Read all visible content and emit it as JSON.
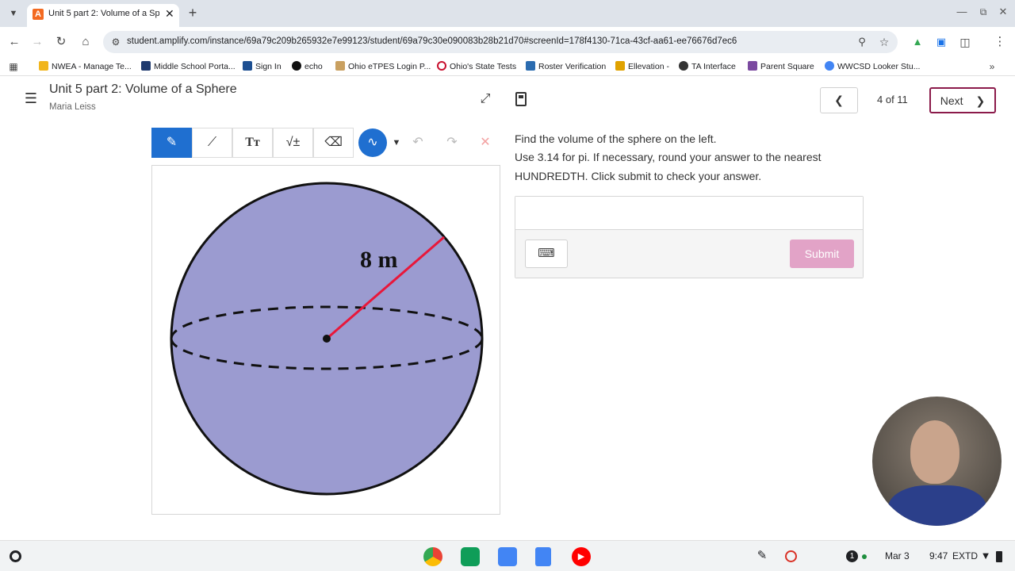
{
  "browser": {
    "tab_title": "Unit 5 part 2: Volume of a Sphe",
    "tab_favicon_letter": "A",
    "url": "student.amplify.com/instance/69a79c209b265932e7e99123/student/69a79c30e090083b28b21d70#screenId=178f4130-71ca-43cf-aa61-ee76676d7ec6",
    "bookmarks": [
      {
        "label": "NWEA - Manage Te...",
        "color": "#f1b51c"
      },
      {
        "label": "Middle School Porta...",
        "color": "#1f3a6e"
      },
      {
        "label": "Sign In",
        "color": "#1d4f91"
      },
      {
        "label": "echo",
        "color": "#111111"
      },
      {
        "label": "Ohio eTPES Login P...",
        "color": "#c9a060"
      },
      {
        "label": "Ohio's State Tests",
        "color": "#c8102e"
      },
      {
        "label": "Roster Verification",
        "color": "#2b6cb0"
      },
      {
        "label": "Ellevation -",
        "color": "#e0a200"
      },
      {
        "label": "TA Interface",
        "color": "#333333"
      },
      {
        "label": "Parent Square",
        "color": "#7b4aa0"
      },
      {
        "label": "WWCSD Looker Stu...",
        "color": "#4285f4"
      }
    ]
  },
  "header": {
    "title": "Unit 5 part 2: Volume of a Sphere",
    "student": "Maria Leiss",
    "page_count": "4 of 11",
    "next_label": "Next"
  },
  "figure": {
    "radius_label": "8 m",
    "fill_color": "#9b9bd0",
    "radius_color": "#e8173a"
  },
  "question": {
    "line1": "Find the volume of the sphere on the left.",
    "line2": "Use 3.14 for pi. If necessary, round your answer to the nearest",
    "line3": "HUNDREDTH. Click submit to check your answer.",
    "answer_value": "",
    "submit_label": "Submit"
  },
  "shelf": {
    "date": "Mar 3",
    "time": "9:47",
    "tz": "EXTD",
    "notif_count": "1"
  },
  "colors": {
    "accent_blue": "#1f6fd0",
    "next_border": "#8b1a4a",
    "submit": "#e2a3c7"
  }
}
